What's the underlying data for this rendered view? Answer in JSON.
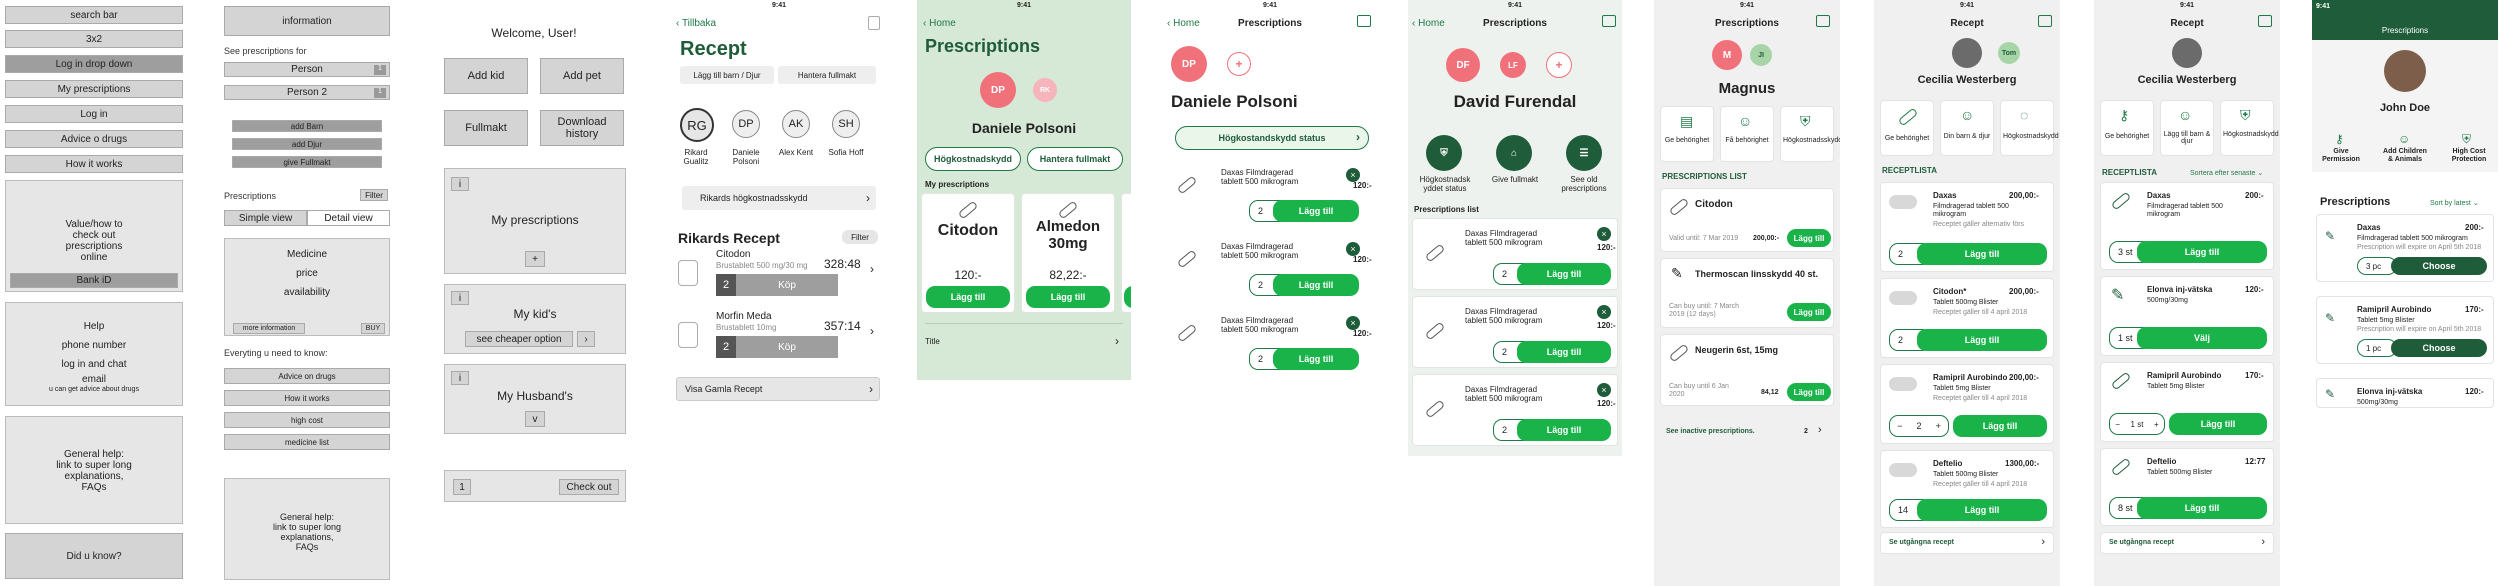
{
  "wf1": {
    "search": "search bar",
    "threex2": "3x2",
    "login_dropdown": "Log in drop down",
    "my_prescriptions": "My prescriptions",
    "login": "Log in",
    "advice": "Advice o drugs",
    "how": "How it works",
    "value_lines": [
      "Value/how to",
      "check out",
      "prescriptions",
      "online"
    ],
    "bankid": "Bank iD",
    "help_lines": [
      "Help",
      "phone number",
      "log in and chat",
      "email"
    ],
    "help_small": "u can get advice about drugs",
    "general_lines": [
      "General help:",
      "link to super long",
      "explanations,",
      "FAQs"
    ],
    "did_u_know": "Did u know?"
  },
  "wf2": {
    "information": "information",
    "see_for": "See prescriptions for",
    "person": "Person",
    "person2": "Person 2",
    "badge1": "1",
    "badge2": "1",
    "add_barn": "add Barn",
    "add_djur": "add Djur",
    "give_fullmakt": "give Fullmakt",
    "prescriptions": "Prescriptions",
    "filter": "Filter",
    "simple": "Simple view",
    "detail": "Detail view",
    "medicine": "Medicine",
    "price": "price",
    "availability": "availability",
    "more_info": "more information",
    "buy": "BUY",
    "everything": "Everyting u need to know:",
    "advice": "Advice on drugs",
    "how": "How it works",
    "high_cost": "high cost",
    "medicine_list": "medicine list",
    "general_lines": [
      "General help:",
      "link to super long",
      "explanations,",
      "FAQs"
    ]
  },
  "wf3": {
    "welcome": "Welcome, User!",
    "add_kid": "Add kid",
    "add_pet": "Add pet",
    "fullmakt": "Fullmakt",
    "download": "Download history",
    "i": "i",
    "my_prescriptions": "My prescriptions",
    "plus": "+",
    "my_kids": "My kid's",
    "cheaper": "see cheaper option",
    "arrow": "›",
    "husband": "My Husband's",
    "v": "v",
    "one": "1",
    "checkout": "Check out"
  },
  "s4": {
    "back": "Tillbaka",
    "title": "Recept",
    "add_child": "Lägg till barn / Djur",
    "manage": "Hantera fullmakt",
    "people": [
      {
        "initials": "RG",
        "name": "Rikard Gualitz"
      },
      {
        "initials": "DP",
        "name": "Daniele Polsoni"
      },
      {
        "initials": "AK",
        "name": "Alex Kent"
      },
      {
        "initials": "SH",
        "name": "Sofia Hoff"
      }
    ],
    "hk": "Rikards högkostnadsskydd",
    "section": "Rikards Recept",
    "filter": "Filter",
    "items": [
      {
        "name": "Citodon",
        "sub": "Brustablett 500 mg/30 mg",
        "price": "328:48",
        "qty": "2",
        "buy": "Köp"
      },
      {
        "name": "Morfin Meda",
        "sub": "Brustablett 10mg",
        "price": "357:14",
        "qty": "2",
        "buy": "Köp"
      }
    ],
    "old": "Visa Gamla Recept",
    "time": "9:41"
  },
  "s5": {
    "home": "Home",
    "title": "Prescriptions",
    "dp": "DP",
    "av2": "RK",
    "name": "Daniele Polsoni",
    "hk": "Högkostnadskydd",
    "fullmakt": "Hantera fullmakt",
    "my": "My prescriptions",
    "cards": [
      {
        "name": "Citodon",
        "price": "120:-",
        "btn": "Lägg till"
      },
      {
        "name": "Almedon 30mg",
        "price": "82,22:-",
        "btn": "Lägg till"
      }
    ],
    "title2": "Title",
    "time": "9:41"
  },
  "s6": {
    "home": "Home",
    "title": "Prescriptions",
    "dp": "DP",
    "plus": "+",
    "name": "Daniele Polsoni",
    "status": "Högkostandskydd status",
    "items": [
      {
        "text": "Daxas Filmdragerad tablett 500 mikrogram",
        "price": "120:-",
        "qty": "2",
        "btn": "Lägg till"
      },
      {
        "text": "Daxas Filmdragerad tablett 500 mikrogram",
        "price": "120:-",
        "qty": "2",
        "btn": "Lägg till"
      },
      {
        "text": "Daxas Filmdragerad tablett 500 mikrogram",
        "price": "120:-",
        "qty": "2",
        "btn": "Lägg till"
      }
    ],
    "time": "9:41"
  },
  "s7": {
    "home": "Home",
    "title": "Prescriptions",
    "df": "DF",
    "av2": "LF",
    "plus": "+",
    "name": "David Furendal",
    "actions": [
      "Högkostnadsk yddet status",
      "Give fullmakt",
      "See old prescriptions"
    ],
    "list": "Prescriptions list",
    "items": [
      {
        "text": "Daxas Filmdragerad tablett 500 mikrogram",
        "price": "120:-",
        "qty": "2",
        "btn": "Lägg till"
      },
      {
        "text": "Daxas Filmdragerad tablett 500 mikrogram",
        "price": "120:-",
        "qty": "2",
        "btn": "Lägg till"
      },
      {
        "text": "Daxas Filmdragerad tablett 500 mikrogram",
        "price": "120:-",
        "qty": "2",
        "btn": "Lägg till"
      }
    ],
    "time": "9:41"
  },
  "s8": {
    "title": "Prescriptions",
    "m": "M",
    "j": "JI",
    "name": "Magnus",
    "actions": [
      "Ge behörighet",
      "Få behörighet",
      "Högkostnadsskydd"
    ],
    "list": "PRESCRIPTIONS LIST",
    "items": [
      {
        "name": "Citodon",
        "sub": "Valid until: 7 Mar 2019",
        "price": "200,00:-",
        "btn": "Lägg till"
      },
      {
        "name": "Thermoscan linsskydd 40 st.",
        "sub": "Can buy until: 7 March 2019 (12 days)",
        "price": "",
        "btn": "Lägg till"
      },
      {
        "name": "Neugerin 6st, 15mg",
        "sub": "Can buy until 6 Jan 2020",
        "price": "84,12",
        "btn": "Lägg till"
      }
    ],
    "inactive": "See inactive prescriptions.",
    "count": "2",
    "time": "9:41"
  },
  "s9": {
    "title": "Recept",
    "tom": "Tom",
    "name": "Cecilia Westerberg",
    "actions": [
      "Ge behörighet",
      "Din barn & djur",
      "Högkostnadskydd"
    ],
    "list": "RECEPTLISTA",
    "items": [
      {
        "name": "Daxas",
        "sub": "Filmdragerad tablett 500 mikrogram",
        "note": "Receptet gäller alternativ förs",
        "price": "200,00:-",
        "qty": "2",
        "btn": "Lägg till"
      },
      {
        "name": "Citodon*",
        "sub": "Tablett 500mg Blister",
        "note": "Receptet gäller till 4 april 2018",
        "price": "200,00:-",
        "qty": "2",
        "btn": "Lägg till"
      },
      {
        "name": "Ramipril Aurobindo",
        "sub": "Tablett 5mg Blister",
        "note": "Receptet gäller till 4 april 2018",
        "price": "200,00:-",
        "qty": "2",
        "btn": "Lägg till"
      },
      {
        "name": "Deftelio",
        "sub": "Tablett 500mg Blister",
        "note": "Receptet gäller till 4 april 2018",
        "price": "1300,00:-",
        "qty": "14",
        "btn": "Lägg till"
      }
    ],
    "expired": "Se utgångna recept",
    "time": "9:41"
  },
  "s10": {
    "title": "Recept",
    "name": "Cecilia Westerberg",
    "actions": [
      "Ge behörighet",
      "Lägg till barn & djur",
      "Högkostnadskydd"
    ],
    "list": "RECEPTLISTA",
    "sort": "Sortera efter senaste",
    "items": [
      {
        "name": "Daxas",
        "sub": "Filmdragerad tablett 500 mikrogram",
        "price": "200:-",
        "qty": "3 st",
        "btn": "Lägg till"
      },
      {
        "name": "Elonva inj-vätska",
        "sub": "500mg/30mg",
        "price": "120:-",
        "qty": "1 st",
        "btn": "Välj"
      },
      {
        "name": "Ramipril Aurobindo",
        "sub": "Tablett 5mg Blister",
        "price": "170:-",
        "qty": "1 st",
        "btn": "Lägg till"
      },
      {
        "name": "Deftelio",
        "sub": "Tablett 500mg Blister",
        "price": "12:77",
        "qty": "8 st",
        "btn": "Lägg till"
      }
    ],
    "expired": "Se utgångna recept",
    "time": "9:41"
  },
  "s11": {
    "title": "Prescriptions",
    "name": "John Doe",
    "actions": [
      "Give Permission",
      "Add Children & Animals",
      "High Cost Protection"
    ],
    "section": "Prescriptions",
    "sort": "Sort by latest",
    "items": [
      {
        "name": "Daxas",
        "sub": "Filmdragerad tablett 500 mikrogram",
        "note": "Prescription will expire on April 5th 2018",
        "price": "200:-",
        "qty": "3 pc",
        "btn": "Choose"
      },
      {
        "name": "Ramipril Aurobindo",
        "sub": "Tablett 5mg Blister",
        "note": "Prescription will expire on April 5th 2018",
        "price": "170:-",
        "qty": "1 pc",
        "btn": "Choose"
      },
      {
        "name": "Elonva inj-vätska",
        "sub": "500mg/30mg",
        "price": "120:-"
      }
    ],
    "time": "9:41"
  }
}
